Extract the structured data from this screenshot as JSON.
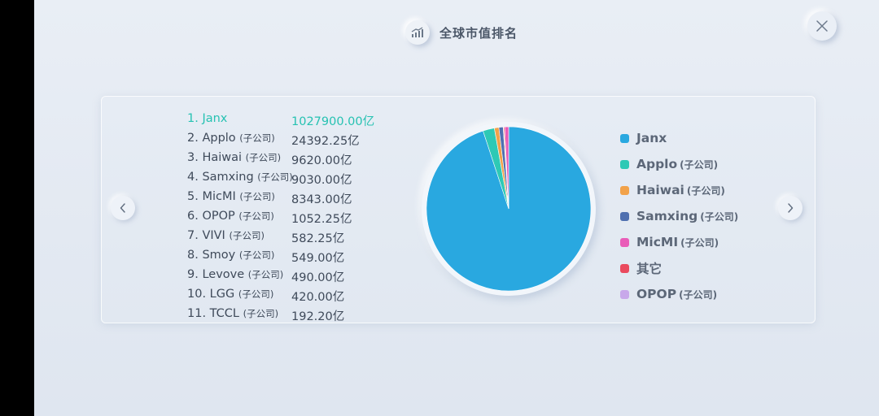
{
  "header": {
    "title": "全球市值排名",
    "icon": "growth-chart-icon"
  },
  "nav": {
    "prev_icon": "chevron-left-icon",
    "next_icon": "chevron-right-icon",
    "close_icon": "close-icon"
  },
  "ranking": [
    {
      "label": "1. Janx",
      "sub": "",
      "value": "1027900.00亿"
    },
    {
      "label": "2. Applo",
      "sub": "(子公司)",
      "value": "24392.25亿"
    },
    {
      "label": "3. Haiwai",
      "sub": "(子公司)",
      "value": "9620.00亿"
    },
    {
      "label": "4. Samxing",
      "sub": "(子公司)",
      "value": "9030.00亿"
    },
    {
      "label": "5. MicMI",
      "sub": "(子公司)",
      "value": "8343.00亿"
    },
    {
      "label": "6. OPOP",
      "sub": "(子公司)",
      "value": "1052.25亿"
    },
    {
      "label": "7. VIVI",
      "sub": "(子公司)",
      "value": "582.25亿"
    },
    {
      "label": "8. Smoy",
      "sub": "(子公司)",
      "value": "549.00亿"
    },
    {
      "label": "9. Levove",
      "sub": "(子公司)",
      "value": "490.00亿"
    },
    {
      "label": "10. LGG",
      "sub": "(子公司)",
      "value": "420.00亿"
    },
    {
      "label": "11. TCCL",
      "sub": "(子公司)",
      "value": "192.20亿"
    }
  ],
  "chart_data": {
    "type": "pie",
    "slices": [
      {
        "name": "Janx",
        "sub": "",
        "value": 1027900.0,
        "color": "#29a8e0"
      },
      {
        "name": "Applo",
        "sub": "(子公司)",
        "value": 24392.25,
        "color": "#2ec9b5"
      },
      {
        "name": "Haiwai",
        "sub": "(子公司)",
        "value": 9620.0,
        "color": "#f2a24a"
      },
      {
        "name": "Samxing",
        "sub": "(子公司)",
        "value": 9030.0,
        "color": "#4f70b0"
      },
      {
        "name": "MicMI",
        "sub": "(子公司)",
        "value": 8343.0,
        "color": "#e95cb8"
      },
      {
        "name": "其它",
        "sub": "",
        "value": 2233.45,
        "color": "#ea4a5e"
      },
      {
        "name": "OPOP",
        "sub": "(子公司)",
        "value": 1052.25,
        "color": "#c8a8ea"
      }
    ]
  }
}
